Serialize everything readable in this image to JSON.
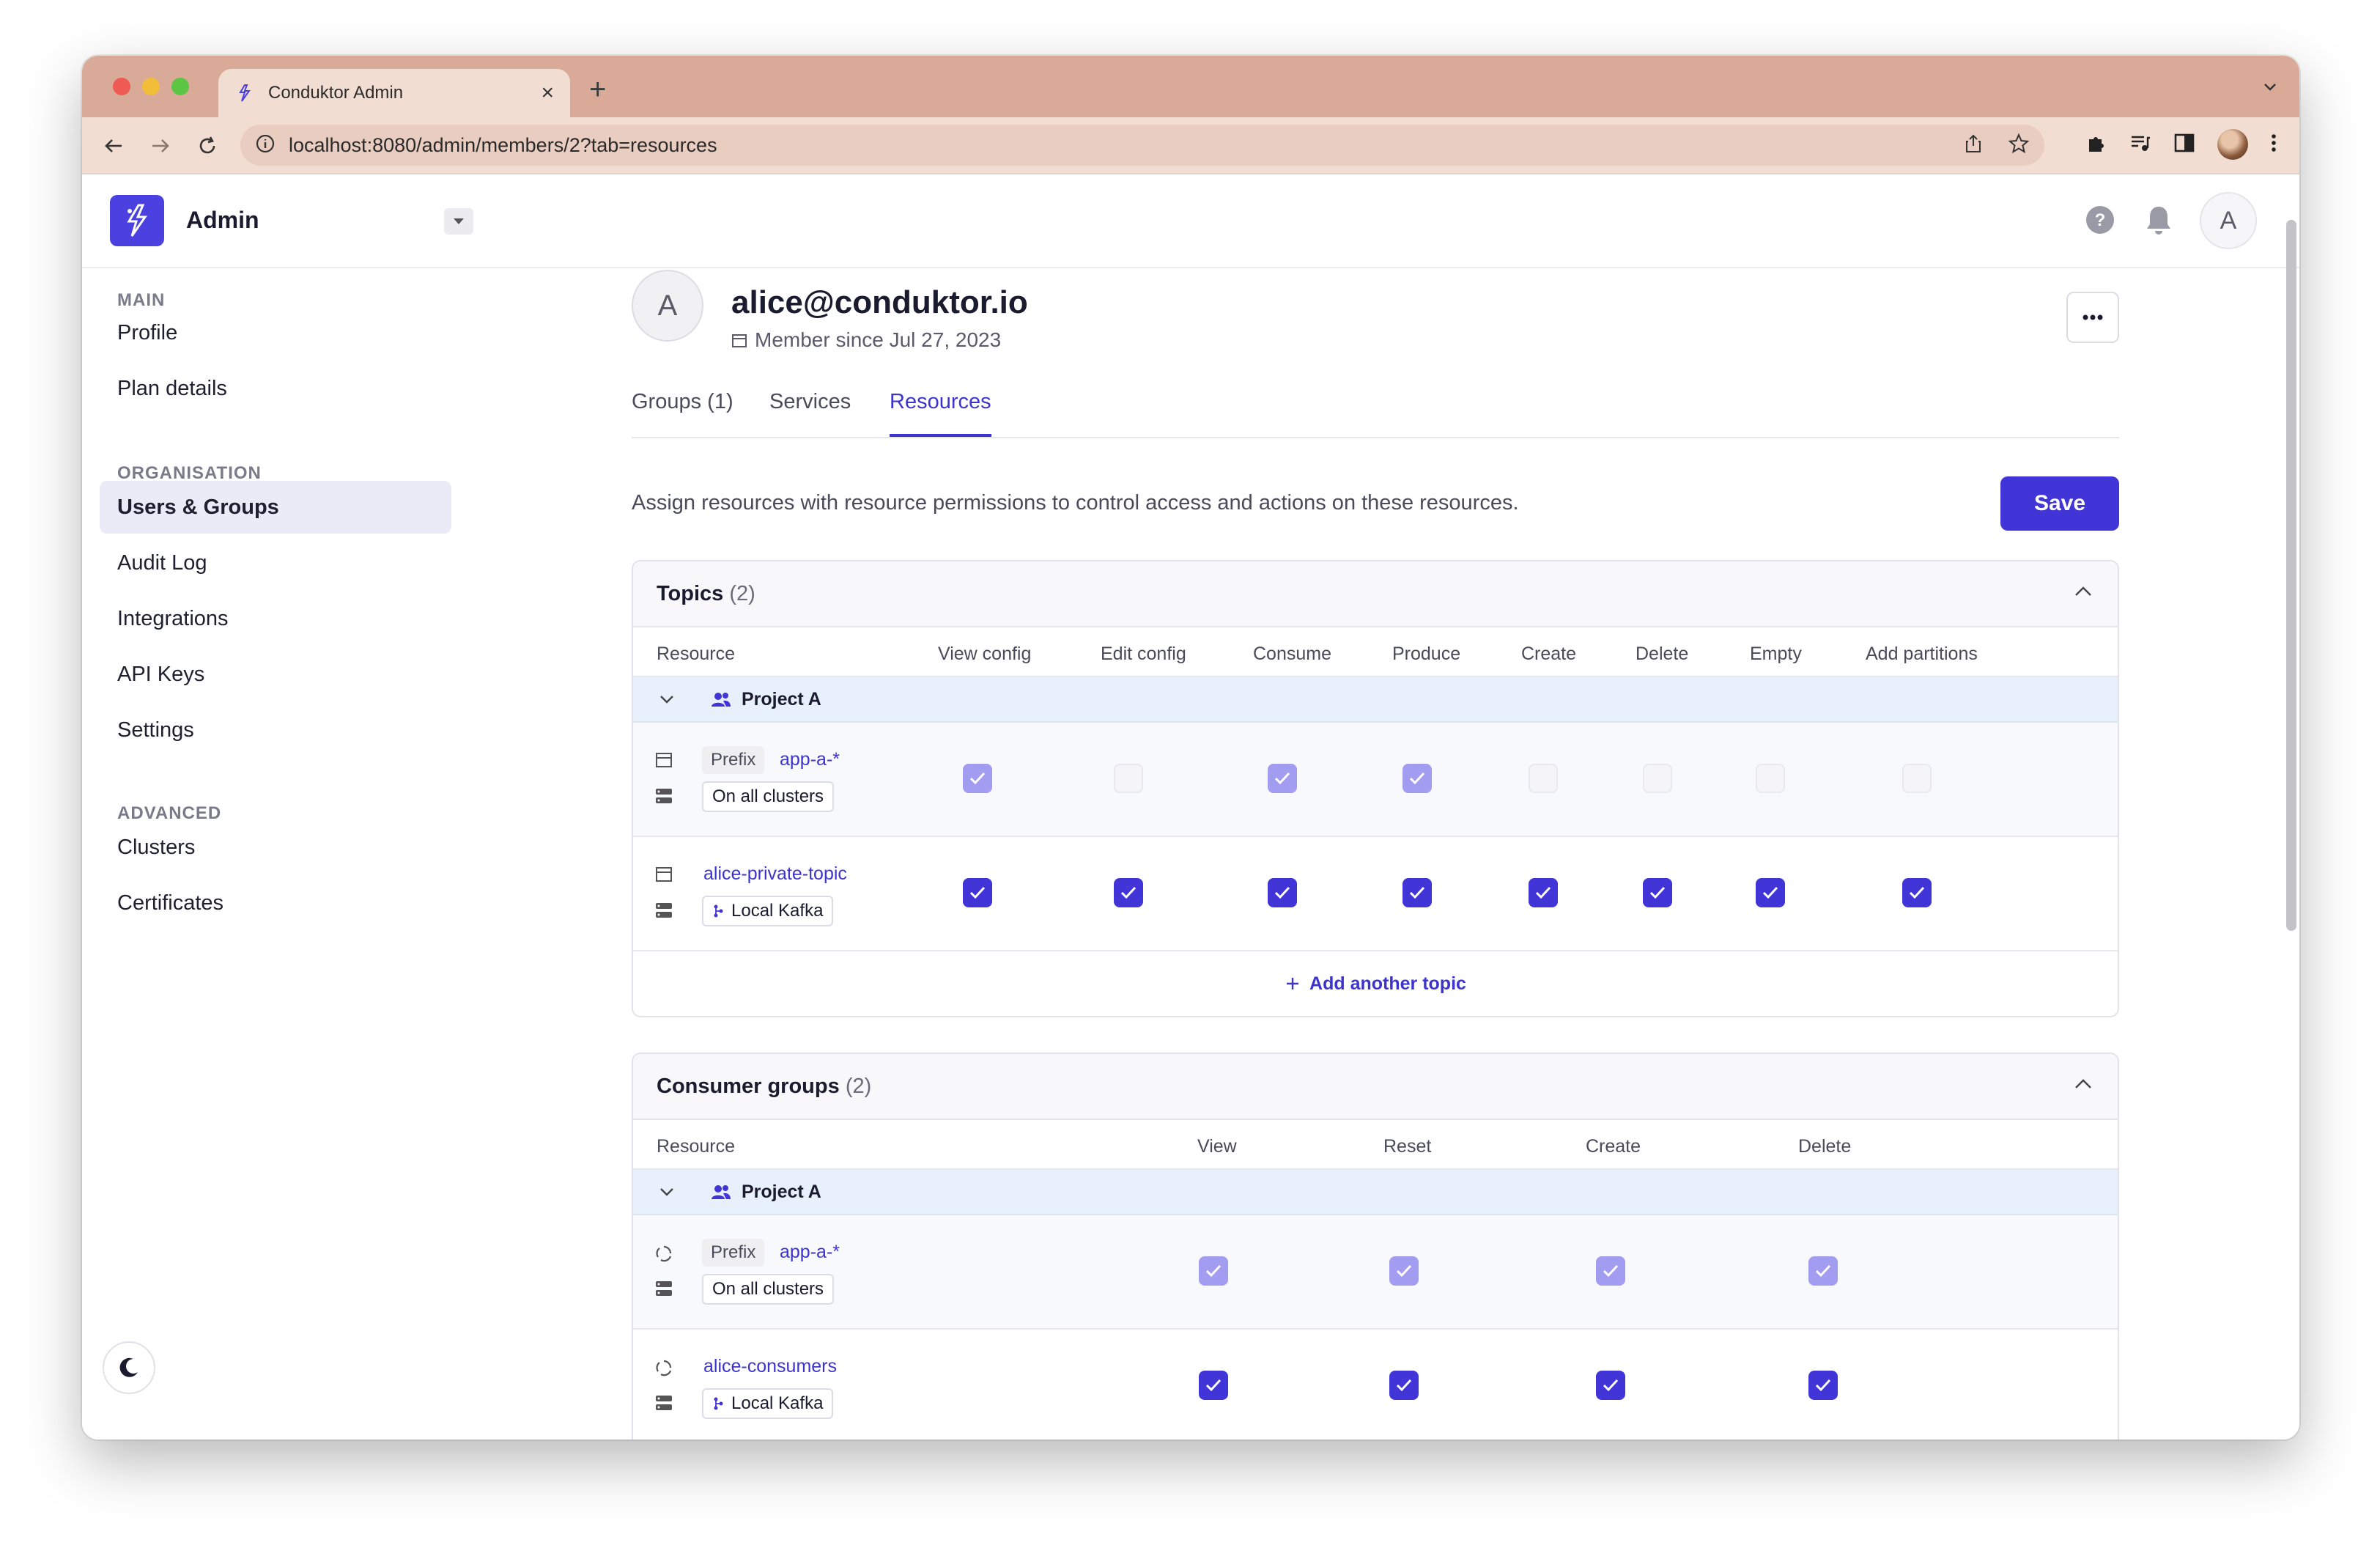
{
  "browser": {
    "tab_title": "Conduktor Admin",
    "url": "localhost:8080/admin/members/2?tab=resources"
  },
  "app": {
    "name": "Admin",
    "header_avatar_letter": "A"
  },
  "sidebar": {
    "sections": [
      {
        "label": "MAIN",
        "items": [
          "Profile",
          "Plan details"
        ]
      },
      {
        "label": "ORGANISATION",
        "items": [
          "Users & Groups",
          "Audit Log",
          "Integrations",
          "API Keys",
          "Settings"
        ]
      },
      {
        "label": "ADVANCED",
        "items": [
          "Clusters",
          "Certificates"
        ]
      }
    ],
    "active_item": "Users & Groups"
  },
  "user": {
    "avatar_letter": "A",
    "email": "alice@conduktor.io",
    "member_since": "Member since Jul 27, 2023"
  },
  "tabs": [
    "Groups (1)",
    "Services",
    "Resources"
  ],
  "active_tab": "Resources",
  "description": "Assign resources with resource permissions to control access and actions on these resources.",
  "save_label": "Save",
  "topics": {
    "title": "Topics",
    "count": "(2)",
    "columns": [
      "Resource",
      "View config",
      "Edit config",
      "Consume",
      "Produce",
      "Create",
      "Delete",
      "Empty",
      "Add partitions"
    ],
    "group": "Project A",
    "rows": [
      {
        "prefix_label": "Prefix",
        "name": "app-a-*",
        "cluster": "On all clusters",
        "perms": [
          "light",
          "off",
          "light",
          "light",
          "off",
          "off",
          "off",
          "off"
        ]
      },
      {
        "prefix_label": "",
        "name": "alice-private-topic",
        "cluster": "Local Kafka",
        "perms": [
          "on",
          "on",
          "on",
          "on",
          "on",
          "on",
          "on",
          "on"
        ]
      }
    ],
    "add_label": "Add another topic"
  },
  "consumer_groups": {
    "title": "Consumer groups",
    "count": "(2)",
    "columns": [
      "Resource",
      "View",
      "Reset",
      "Create",
      "Delete"
    ],
    "group": "Project A",
    "rows": [
      {
        "prefix_label": "Prefix",
        "name": "app-a-*",
        "cluster": "On all clusters",
        "perms": [
          "light",
          "light",
          "light",
          "light"
        ]
      },
      {
        "prefix_label": "",
        "name": "alice-consumers",
        "cluster": "Local Kafka",
        "perms": [
          "on",
          "on",
          "on",
          "on"
        ]
      }
    ]
  },
  "colors": {
    "accent": "#4235d8",
    "accent_light": "#a29df0",
    "group_row_bg": "#e8f1fb",
    "titlebar": "#d9aa98"
  }
}
